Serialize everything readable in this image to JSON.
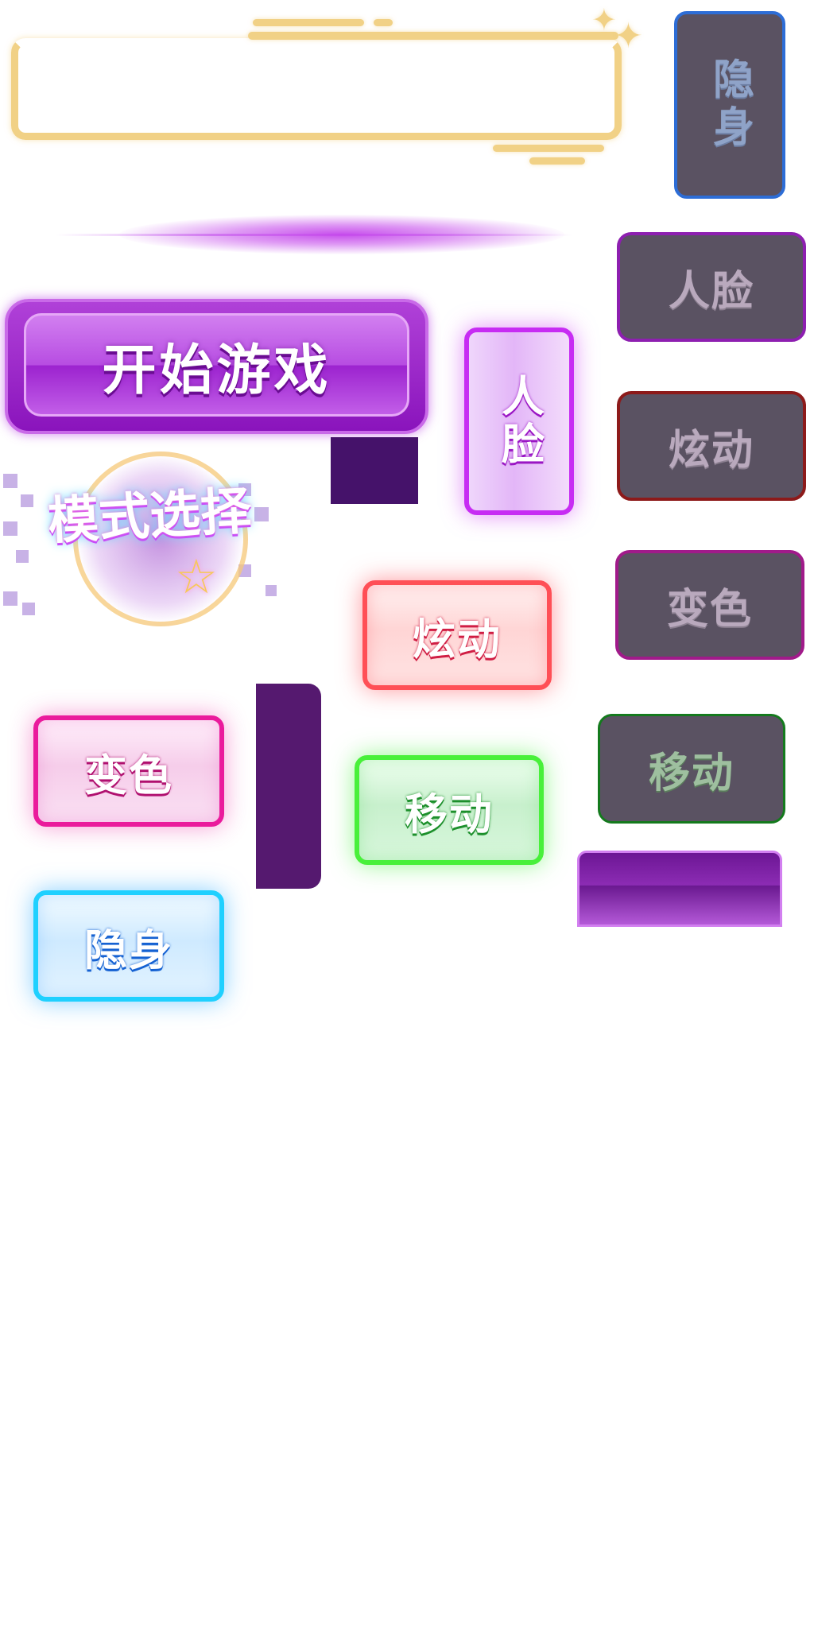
{
  "buttons": {
    "start_game": "开始游戏",
    "mode_select": "模式选择",
    "face_vertical": "人脸",
    "dazzle_active": "炫动",
    "move_active": "移动",
    "color_active": "变色",
    "hide_active": "隐身"
  },
  "disabled_buttons": {
    "hide": "隐身",
    "face": "人脸",
    "dazzle": "炫动",
    "color": "变色",
    "move": "移动"
  },
  "colors": {
    "gold_frame": "#f1d186",
    "primary_purple": "#9c23cf",
    "red_neon": "#ff4f56",
    "green_neon": "#48f03a",
    "pink_neon": "#ea1b9c",
    "cyan_neon": "#1fd0ff",
    "violet_neon": "#c72cf3",
    "disabled_bg": "#5a5262"
  },
  "icons": [
    "sparkle-icon",
    "star-icon"
  ]
}
